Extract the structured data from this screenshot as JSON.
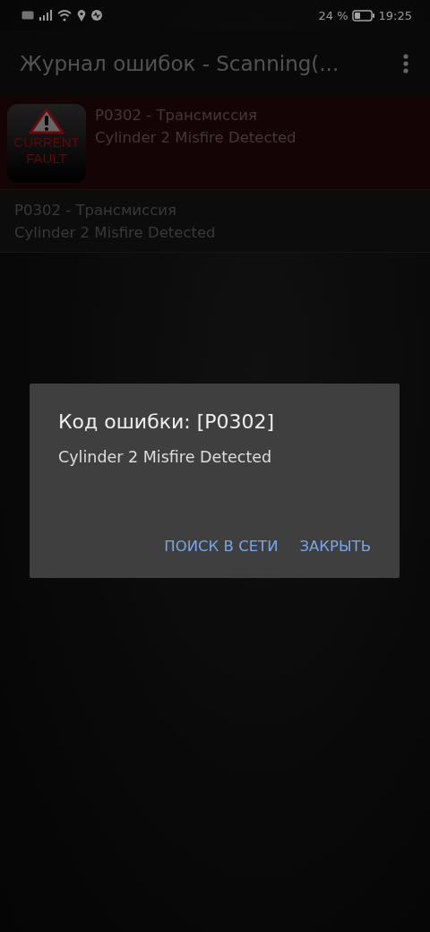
{
  "status_bar": {
    "battery_text": "24 %",
    "time": "19:25"
  },
  "app_bar": {
    "title": "Журнал ошибок - Scanning(..."
  },
  "faults": [
    {
      "kind": "current",
      "badge": [
        "CURRENT",
        "FAULT"
      ],
      "code": "P0302 - Трансмиссия",
      "description": "Cylinder 2 Misfire Detected"
    },
    {
      "kind": "history",
      "code": "P0302 - Трансмиссия",
      "description": "Cylinder 2 Misfire Detected"
    }
  ],
  "dialog": {
    "title": "Код ошибки: [P0302]",
    "message": "Cylinder 2 Misfire Detected",
    "buttons": [
      "ПОИСК В СЕТИ",
      "ЗАКРЫТЬ"
    ]
  }
}
